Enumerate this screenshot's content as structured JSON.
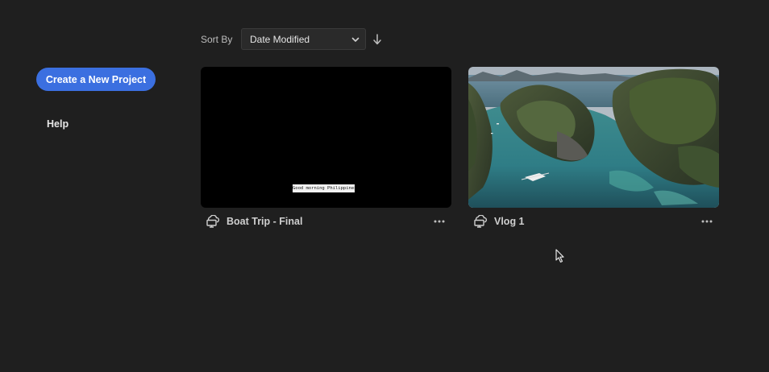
{
  "sidebar": {
    "create_button": "Create a New Project",
    "help": "Help"
  },
  "sort": {
    "label": "Sort By",
    "selected": "Date Modified"
  },
  "projects": [
    {
      "title": "Boat Trip - Final",
      "thumbnail_caption": "Good morning Philippines!"
    },
    {
      "title": "Vlog 1"
    }
  ],
  "colors": {
    "background": "#1f1f1f",
    "accent": "#3b6fe0"
  },
  "icons": {
    "sort_direction": "arrow-down-icon",
    "dropdown": "chevron-down-icon",
    "cloud": "cloud-sync-icon",
    "more": "more-horizontal-icon"
  }
}
